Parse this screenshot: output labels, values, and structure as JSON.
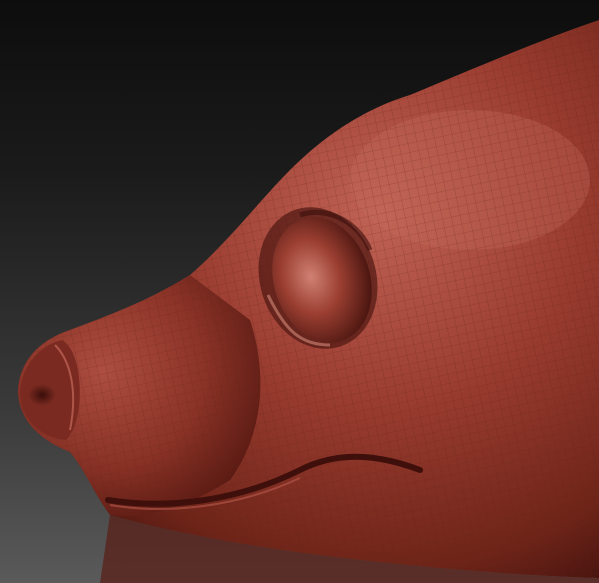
{
  "viewport": {
    "background_top": "#0d0d0d",
    "background_bottom": "#5a5a5a",
    "model_name_icon": "sculpt-model-icon"
  },
  "model": {
    "base_color": "#8e3529",
    "highlight_color": "#c46a5d",
    "shadow_color": "#4a1510",
    "wire_color": "#5e1e16"
  }
}
